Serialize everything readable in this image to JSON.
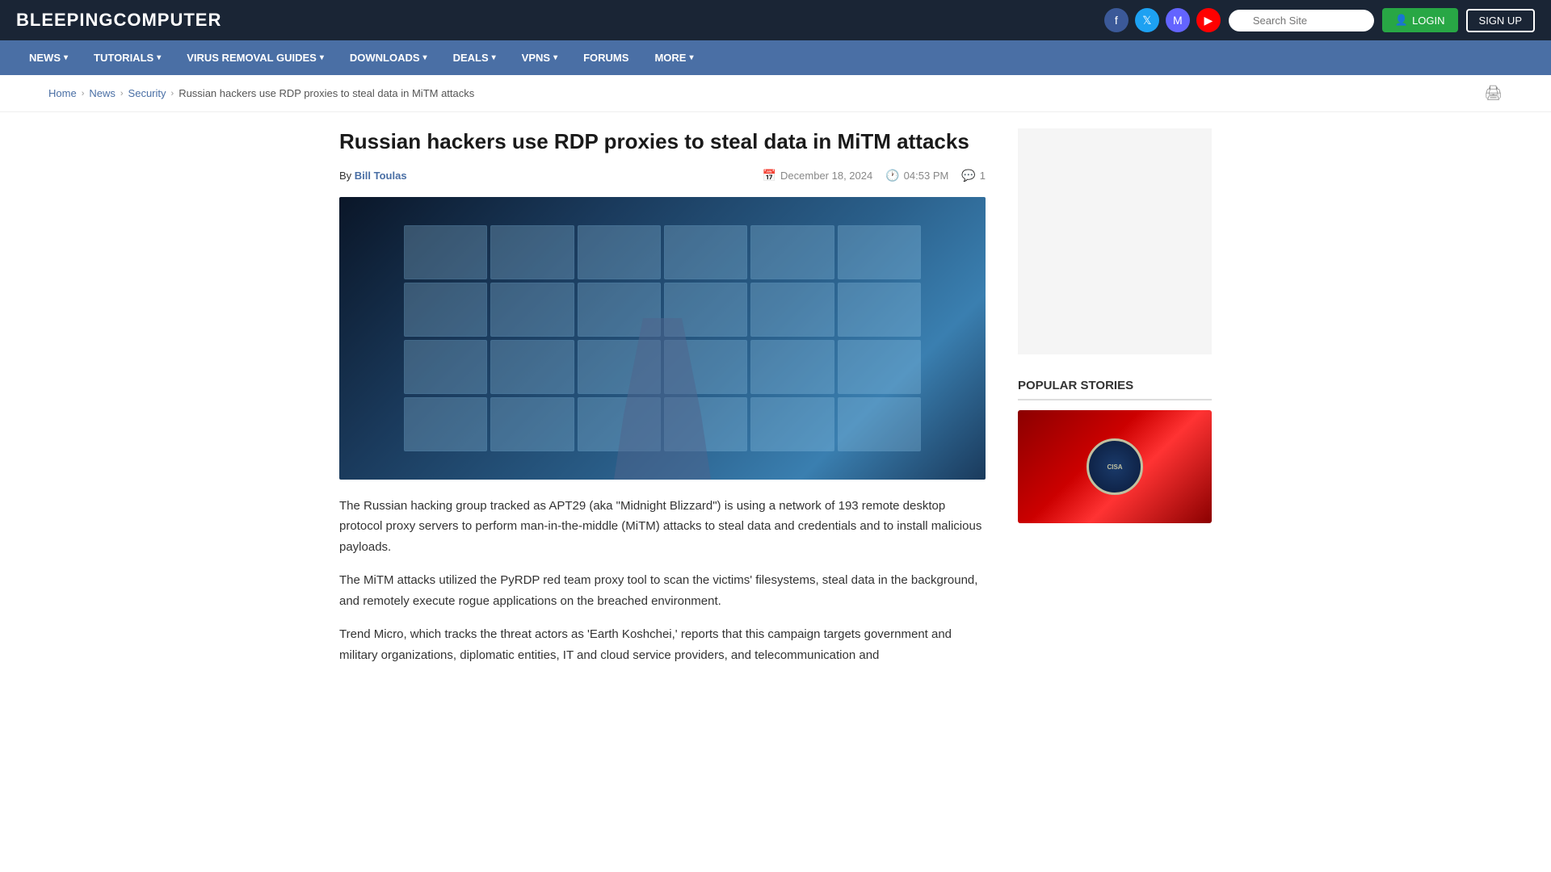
{
  "header": {
    "logo_prefix": "BLEEPING",
    "logo_suffix": "COMPUTER",
    "search_placeholder": "Search Site",
    "login_label": "LOGIN",
    "signup_label": "SIGN UP"
  },
  "nav": {
    "items": [
      {
        "label": "NEWS",
        "has_arrow": true
      },
      {
        "label": "TUTORIALS",
        "has_arrow": true
      },
      {
        "label": "VIRUS REMOVAL GUIDES",
        "has_arrow": true
      },
      {
        "label": "DOWNLOADS",
        "has_arrow": true
      },
      {
        "label": "DEALS",
        "has_arrow": true
      },
      {
        "label": "VPNS",
        "has_arrow": true
      },
      {
        "label": "FORUMS",
        "has_arrow": false
      },
      {
        "label": "MORE",
        "has_arrow": true
      }
    ]
  },
  "breadcrumb": {
    "home": "Home",
    "news": "News",
    "security": "Security",
    "current": "Russian hackers use RDP proxies to steal data in MiTM attacks"
  },
  "article": {
    "title": "Russian hackers use RDP proxies to steal data in MiTM attacks",
    "author": "Bill Toulas",
    "date": "December 18, 2024",
    "time": "04:53 PM",
    "comments": "1",
    "body": [
      "The Russian hacking group tracked as APT29 (aka \"Midnight Blizzard\") is using a network of 193 remote desktop protocol proxy servers to perform man-in-the-middle (MiTM) attacks to steal data and credentials and to install malicious payloads.",
      "The MiTM attacks utilized the PyRDP red team proxy tool to scan the victims' filesystems, steal data in the background, and remotely execute rogue applications on the breached environment.",
      "Trend Micro, which tracks the threat actors as 'Earth Koshchei,' reports that this campaign targets government and military organizations, diplomatic entities, IT and cloud service providers, and telecommunication and"
    ]
  },
  "sidebar": {
    "popular_stories_title": "POPULAR STORIES"
  }
}
